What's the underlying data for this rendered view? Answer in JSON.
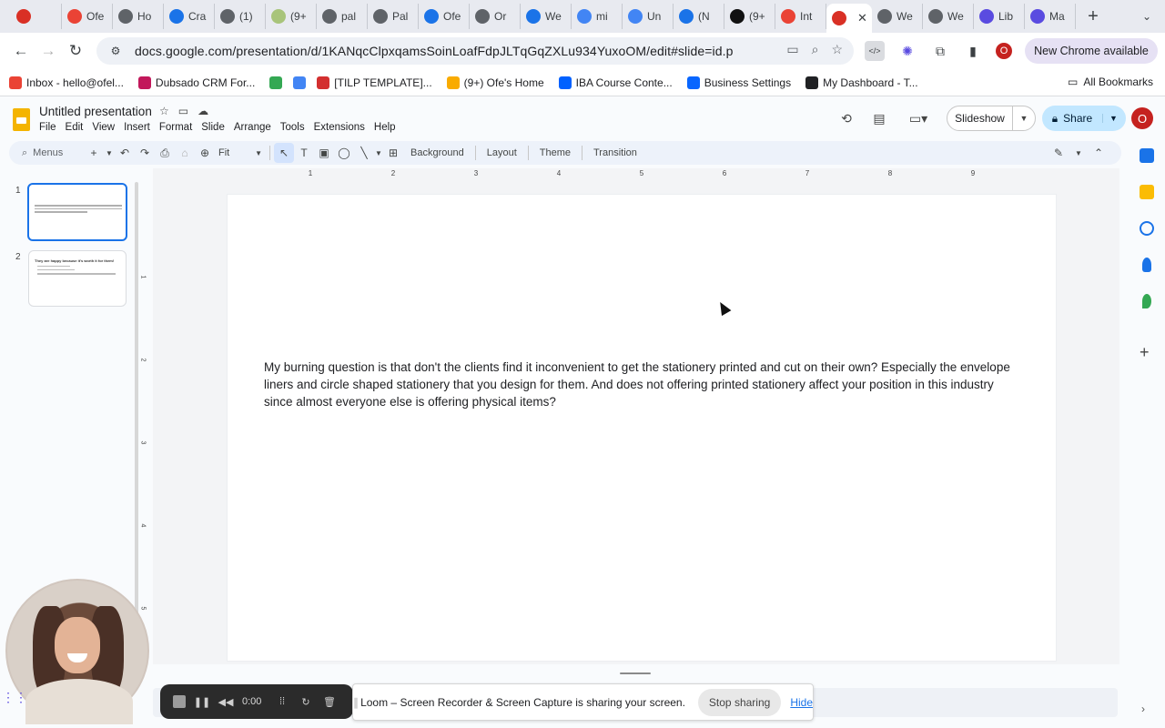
{
  "browser": {
    "tabs": [
      {
        "label": "",
        "icon": "loom-record-icon",
        "color": "#d93025"
      },
      {
        "label": "Ofe",
        "icon": "gmail-icon",
        "color": "#ea4335"
      },
      {
        "label": "Ho",
        "icon": "web-icon",
        "color": "#5f6368"
      },
      {
        "label": "Cra",
        "icon": "canva-icon",
        "color": "#1a73e8"
      },
      {
        "label": "(1)",
        "icon": "web-icon",
        "color": "#5f6368"
      },
      {
        "label": "(9+",
        "icon": "notes-icon",
        "color": "#a8c47a"
      },
      {
        "label": "pal",
        "icon": "web-icon",
        "color": "#5f6368"
      },
      {
        "label": "Pal",
        "icon": "web-icon",
        "color": "#5f6368"
      },
      {
        "label": "Ofe",
        "icon": "canva-icon",
        "color": "#1a73e8"
      },
      {
        "label": "Or",
        "icon": "web-icon",
        "color": "#5f6368"
      },
      {
        "label": "We",
        "icon": "canva-icon",
        "color": "#1a73e8"
      },
      {
        "label": "mi",
        "icon": "docs-icon",
        "color": "#4285f4"
      },
      {
        "label": "Un",
        "icon": "docs-icon",
        "color": "#4285f4"
      },
      {
        "label": "(N",
        "icon": "calendar-icon",
        "color": "#1a73e8"
      },
      {
        "label": "(9+",
        "icon": "notion-icon",
        "color": "#111111"
      },
      {
        "label": "Int",
        "icon": "gmail-icon",
        "color": "#ea4335"
      },
      {
        "label": "",
        "icon": "loom-record-icon",
        "color": "#d93025",
        "active": true
      },
      {
        "label": "We",
        "icon": "web-icon",
        "color": "#5f6368"
      },
      {
        "label": "We",
        "icon": "web-icon",
        "color": "#5f6368"
      },
      {
        "label": "Lib",
        "icon": "spark-icon",
        "color": "#5a4be0"
      },
      {
        "label": "Ma",
        "icon": "spark-icon",
        "color": "#5a4be0"
      }
    ],
    "url": "docs.google.com/presentation/d/1KANqcClpxqamsSoinLoafFdpJLTqGqZXLu934YuxoOM/edit#slide=id.p",
    "new_chrome_label": "New Chrome available",
    "profile_initial": "O",
    "bookmarks": [
      {
        "label": "Inbox - hello@ofel...",
        "icon": "gmail-icon",
        "color": "#ea4335"
      },
      {
        "label": "Dubsado CRM For...",
        "icon": "dubsado-icon",
        "color": "#c2185b"
      },
      {
        "label": "",
        "icon": "drive-icon",
        "color": "#34a853"
      },
      {
        "label": "",
        "icon": "docs-icon",
        "color": "#4285f4"
      },
      {
        "label": "[TILP TEMPLATE]...",
        "icon": "template-icon",
        "color": "#d32f2f"
      },
      {
        "label": "(9+) Ofe's Home",
        "icon": "emoji-icon",
        "color": "#f9ab00"
      },
      {
        "label": "IBA Course Conte...",
        "icon": "dropbox-icon",
        "color": "#0061ff"
      },
      {
        "label": "Business Settings",
        "icon": "meta-icon",
        "color": "#0866ff"
      },
      {
        "label": "My Dashboard - T...",
        "icon": "dashboard-icon",
        "color": "#202124"
      }
    ],
    "all_bookmarks_label": "All Bookmarks"
  },
  "slides": {
    "doc_title": "Untitled presentation",
    "menu": [
      "File",
      "Edit",
      "View",
      "Insert",
      "Format",
      "Slide",
      "Arrange",
      "Tools",
      "Extensions",
      "Help"
    ],
    "slideshow_label": "Slideshow",
    "share_label": "Share",
    "avatar_initial": "O",
    "toolbar": {
      "search_placeholder": "Menus",
      "zoom": "Fit",
      "background": "Background",
      "layout": "Layout",
      "theme": "Theme",
      "transition": "Transition"
    },
    "filmstrip": [
      {
        "number": "1",
        "selected": true
      },
      {
        "number": "2",
        "title": "They are happy because it's worth it for them!",
        "selected": false
      }
    ],
    "ruler_h": [
      "1",
      "2",
      "3",
      "4",
      "5",
      "6",
      "7",
      "8",
      "9"
    ],
    "ruler_v": [
      "1",
      "2",
      "3",
      "4",
      "5"
    ],
    "slide_text": "My burning question is that don't the clients find it inconvenient to get the stationery printed and cut on their own? Especially the envelope liners and circle shaped stationery that you design for them. And does not offering printed stationery affect your position in this industry since almost everyone else is offering physical items?"
  },
  "loom": {
    "timer": "0:00",
    "share_message": "Loom – Screen Recorder & Screen Capture is sharing your screen.",
    "stop_sharing_label": "Stop sharing",
    "hide_label": "Hide"
  }
}
